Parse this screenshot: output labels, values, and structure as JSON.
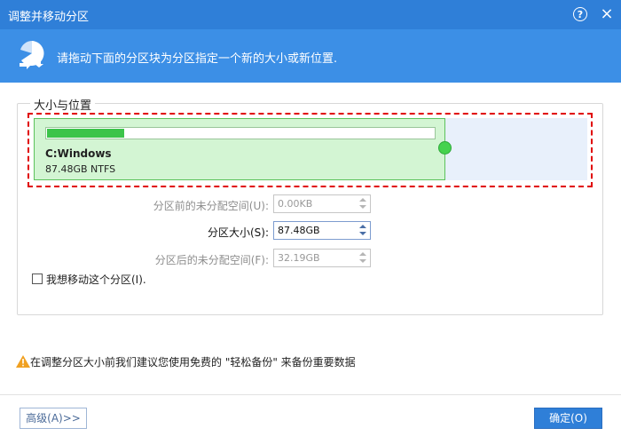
{
  "window": {
    "title": "调整并移动分区",
    "help_icon": "help-icon",
    "close_icon": "close-icon"
  },
  "header": {
    "icon": "partition-move-icon",
    "text": "请拖动下面的分区块为分区指定一个新的大小或新位置."
  },
  "group": {
    "label": "大小与位置"
  },
  "partition": {
    "name": "C:Windows",
    "info": "87.48GB NTFS",
    "used_fraction": 0.2
  },
  "fields": {
    "before": {
      "label": "分区前的未分配空间(U):",
      "value": "0.00KB"
    },
    "size": {
      "label": "分区大小(S):",
      "value": "87.48GB"
    },
    "after": {
      "label": "分区后的未分配空间(F):",
      "value": "32.19GB"
    }
  },
  "move_option": {
    "label": "我想移动这个分区(I).",
    "checked": false
  },
  "warning": {
    "icon": "warning-icon",
    "text": "在调整分区大小前我们建议您使用免费的 \"轻松备份\" 来备份重要数据"
  },
  "buttons": {
    "advanced": "高级(A)>>",
    "ok": "确定(O)"
  },
  "colors": {
    "titlebar": "#2f7fd8",
    "header": "#3c8fe6",
    "partition_used": "#d3f5d3",
    "partition_free": "#e8f0fb",
    "selection_border": "#e00000",
    "progress": "#3cc44a"
  }
}
